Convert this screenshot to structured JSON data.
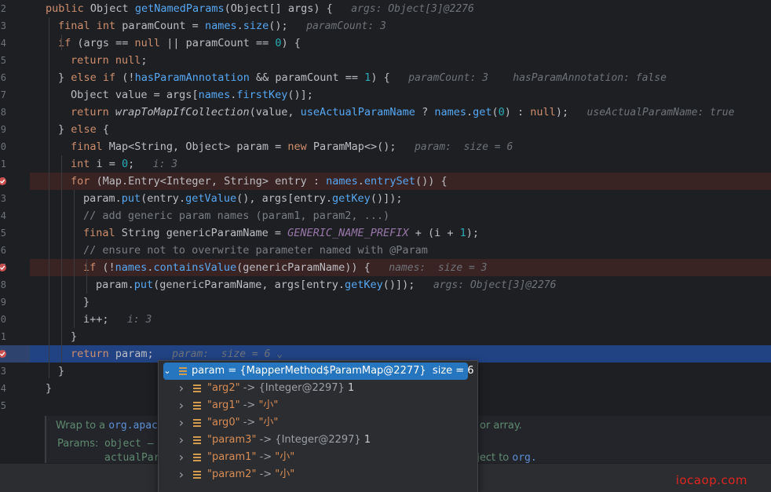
{
  "editor": {
    "lines": [
      {
        "num": "2",
        "segments": [
          [
            "kw",
            "public "
          ],
          [
            "ty",
            "Object "
          ],
          [
            "fn",
            "getNamedParams"
          ],
          [
            "mt",
            "("
          ],
          [
            "ty",
            "Object"
          ],
          [
            "mt",
            "[] args) {"
          ]
        ],
        "hint": "args: Object[3]@2276"
      },
      {
        "num": "3",
        "segments": [
          [
            "kw",
            "final int "
          ],
          [
            "mt",
            "paramCount = "
          ],
          [
            "inv",
            "names"
          ],
          [
            "mt",
            "."
          ],
          [
            "inv",
            "size"
          ],
          [
            "mt",
            "();"
          ]
        ],
        "hint": "paramCount: 3"
      },
      {
        "num": "4",
        "segments": [
          [
            "kw",
            "if "
          ],
          [
            "mt",
            "(args == "
          ],
          [
            "kw",
            "null "
          ],
          [
            "mt",
            "|| paramCount == "
          ],
          [
            "num",
            "0"
          ],
          [
            "mt",
            ") {"
          ]
        ],
        "hint": ""
      },
      {
        "num": "5",
        "segments": [
          [
            "kw",
            "return null"
          ],
          [
            "mt",
            ";"
          ]
        ],
        "hint": ""
      },
      {
        "num": "6",
        "segments": [
          [
            "mt",
            "} "
          ],
          [
            "kw",
            "else if "
          ],
          [
            "mt",
            "(!"
          ],
          [
            "inv",
            "hasParamAnnotation "
          ],
          [
            "mt",
            "&& paramCount == "
          ],
          [
            "num",
            "1"
          ],
          [
            "mt",
            ") {"
          ]
        ],
        "hint": "paramCount: 3    hasParamAnnotation: false"
      },
      {
        "num": "7",
        "segments": [
          [
            "ty",
            "Object "
          ],
          [
            "mt",
            "value = args["
          ],
          [
            "inv",
            "names"
          ],
          [
            "mt",
            "."
          ],
          [
            "inv",
            "firstKey"
          ],
          [
            "mt",
            "()];"
          ]
        ],
        "hint": ""
      },
      {
        "num": "8",
        "segments": [
          [
            "kw",
            "return "
          ],
          [
            "it",
            "wrapToMapIfCollection"
          ],
          [
            "mt",
            "(value, "
          ],
          [
            "inv",
            "useActualParamName "
          ],
          [
            "mt",
            "? "
          ],
          [
            "inv",
            "names"
          ],
          [
            "mt",
            "."
          ],
          [
            "inv",
            "get"
          ],
          [
            "mt",
            "("
          ],
          [
            "num",
            "0"
          ],
          [
            "mt",
            ") : "
          ],
          [
            "kw",
            "null"
          ],
          [
            "mt",
            ");"
          ]
        ],
        "hint": "useActualParamName: true"
      },
      {
        "num": "9",
        "segments": [
          [
            "mt",
            "} "
          ],
          [
            "kw",
            "else "
          ],
          [
            "mt",
            "{"
          ]
        ],
        "hint": ""
      },
      {
        "num": "0",
        "segments": [
          [
            "kw",
            "final "
          ],
          [
            "ty",
            "Map<String, Object> "
          ],
          [
            "mt",
            "param = "
          ],
          [
            "kw",
            "new "
          ],
          [
            "ty",
            "ParamMap<>"
          ],
          [
            "mt",
            "();"
          ]
        ],
        "hint": "param:  size = 6"
      },
      {
        "num": "1",
        "segments": [
          [
            "kw",
            "int "
          ],
          [
            "mt",
            "i = "
          ],
          [
            "num",
            "0"
          ],
          [
            "mt",
            ";"
          ]
        ],
        "hint": "i: 3"
      },
      {
        "num": "2",
        "segments": [
          [
            "kw",
            "for "
          ],
          [
            "mt",
            "(Map.Entry<Integer, String> entry : "
          ],
          [
            "inv",
            "names"
          ],
          [
            "mt",
            "."
          ],
          [
            "inv",
            "entrySet"
          ],
          [
            "mt",
            "()) {"
          ]
        ],
        "hint": ""
      },
      {
        "num": "3",
        "segments": [
          [
            "mt",
            "param."
          ],
          [
            "inv",
            "put"
          ],
          [
            "mt",
            "(entry."
          ],
          [
            "inv",
            "getValue"
          ],
          [
            "mt",
            "(), args[entry."
          ],
          [
            "inv",
            "getKey"
          ],
          [
            "mt",
            "()]);"
          ]
        ],
        "hint": ""
      },
      {
        "num": "4",
        "segments": [
          [
            "cm",
            "// add generic param names (param1, param2, ...)"
          ]
        ],
        "hint": ""
      },
      {
        "num": "5",
        "segments": [
          [
            "kw",
            "final "
          ],
          [
            "ty",
            "String "
          ],
          [
            "mt",
            "genericParamName = "
          ],
          [
            "st",
            "GENERIC_NAME_PREFIX "
          ],
          [
            "mt",
            "+ (i + "
          ],
          [
            "num",
            "1"
          ],
          [
            "mt",
            ");"
          ]
        ],
        "hint": ""
      },
      {
        "num": "6",
        "segments": [
          [
            "cm",
            "// ensure not to overwrite parameter named with @Param"
          ]
        ],
        "hint": ""
      },
      {
        "num": "7",
        "segments": [
          [
            "kw",
            "if "
          ],
          [
            "mt",
            "(!"
          ],
          [
            "inv",
            "names"
          ],
          [
            "mt",
            "."
          ],
          [
            "inv",
            "containsValue"
          ],
          [
            "mt",
            "(genericParamName)) {"
          ]
        ],
        "hint": "names:  size = 3"
      },
      {
        "num": "8",
        "segments": [
          [
            "mt",
            "param."
          ],
          [
            "inv",
            "put"
          ],
          [
            "mt",
            "(genericParamName, args[entry."
          ],
          [
            "inv",
            "getKey"
          ],
          [
            "mt",
            "()]);"
          ]
        ],
        "hint": "args: Object[3]@2276"
      },
      {
        "num": "9",
        "segments": [
          [
            "mt",
            "}"
          ]
        ],
        "hint": ""
      },
      {
        "num": "0",
        "segments": [
          [
            "mt",
            "i++;"
          ]
        ],
        "hint": "i: 3"
      },
      {
        "num": "1",
        "segments": [
          [
            "mt",
            "}"
          ]
        ],
        "hint": ""
      },
      {
        "num": "2",
        "segments": [
          [
            "kw",
            "return "
          ],
          [
            "mt",
            "param;"
          ]
        ],
        "hint": "param:  size = 6"
      },
      {
        "num": "3",
        "segments": [
          [
            "mt",
            "}"
          ]
        ],
        "hint": ""
      },
      {
        "num": "4",
        "segments": [
          [
            "mt",
            "}"
          ]
        ],
        "hint": ""
      },
      {
        "num": "5",
        "segments": [],
        "hint": ""
      }
    ]
  },
  "doc": {
    "line1_prefix": "Wrap to a ",
    "line1_link": "org.apache",
    "line1_suffix": "or array.",
    "params_label": "Params:",
    "line2_text": "object – a",
    "line3_text": "actualPar",
    "line3_suffix": "object to ",
    "line3_link": "org."
  },
  "tree": {
    "root": {
      "text": "param = {MapperMethod$ParamMap@2277}  size = 6"
    },
    "children": [
      {
        "key": "\"arg2\"",
        "arrow": " -> ",
        "type": "{Integer@2297} ",
        "value": "1",
        "kind": "int"
      },
      {
        "key": "\"arg1\"",
        "arrow": " -> ",
        "type": "",
        "value": "\"小\"",
        "kind": "str"
      },
      {
        "key": "\"arg0\"",
        "arrow": " -> ",
        "type": "",
        "value": "\"小\"",
        "kind": "str"
      },
      {
        "key": "\"param3\"",
        "arrow": " -> ",
        "type": "{Integer@2297} ",
        "value": "1",
        "kind": "int"
      },
      {
        "key": "\"param1\"",
        "arrow": " -> ",
        "type": "",
        "value": "\"小\"",
        "kind": "str"
      },
      {
        "key": "\"param2\"",
        "arrow": " -> ",
        "type": "",
        "value": "\"小\"",
        "kind": "str"
      }
    ]
  },
  "watermark": "iocaop.com",
  "colors": {
    "selection": "#2675bf",
    "exec_line": "#214283",
    "breakpoint": "#c94f4f",
    "keyword": "#cf8e6d",
    "method": "#56a8f5"
  }
}
